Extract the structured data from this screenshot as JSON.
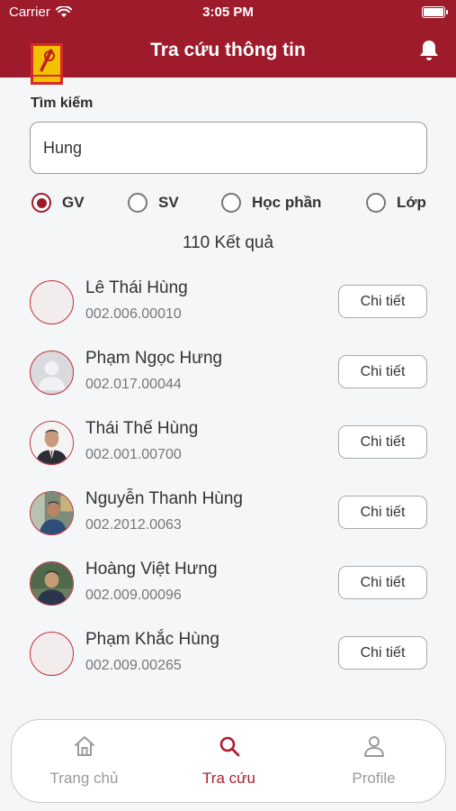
{
  "status_bar": {
    "carrier": "Carrier",
    "time": "3:05 PM"
  },
  "header": {
    "title": "Tra cứu thông tin",
    "logo_text": "BÁCH KHOA"
  },
  "search": {
    "label": "Tìm kiếm",
    "value": "Hung"
  },
  "filters": [
    {
      "label": "GV",
      "selected": true
    },
    {
      "label": "SV",
      "selected": false
    },
    {
      "label": "Học phần",
      "selected": false
    },
    {
      "label": "Lớp",
      "selected": false
    }
  ],
  "result_count": "110 Kết quả",
  "results": [
    {
      "name": "Lê Thái Hùng",
      "code": "002.006.00010",
      "avatar": "blank"
    },
    {
      "name": "Phạm Ngọc Hưng",
      "code": "002.017.00044",
      "avatar": "placeholder-person"
    },
    {
      "name": "Thái Thế Hùng",
      "code": "002.001.00700",
      "avatar": "photo-suit"
    },
    {
      "name": "Nguyễn Thanh Hùng",
      "code": "002.2012.0063",
      "avatar": "photo-casual"
    },
    {
      "name": "Hoàng Việt Hưng",
      "code": "002.009.00096",
      "avatar": "photo-outdoor"
    },
    {
      "name": "Phạm Khắc Hùng",
      "code": "002.009.00265",
      "avatar": "blank"
    }
  ],
  "detail_button_label": "Chi tiết",
  "tabs": [
    {
      "label": "Trang chủ",
      "icon": "home-icon",
      "active": false
    },
    {
      "label": "Tra cứu",
      "icon": "search-icon",
      "active": true
    },
    {
      "label": "Profile",
      "icon": "person-icon",
      "active": false
    }
  ],
  "colors": {
    "primary": "#9e1b2b",
    "active_tab": "#b01e2f",
    "inactive_tab": "#9a9a9a",
    "background": "#f5f6f8"
  }
}
